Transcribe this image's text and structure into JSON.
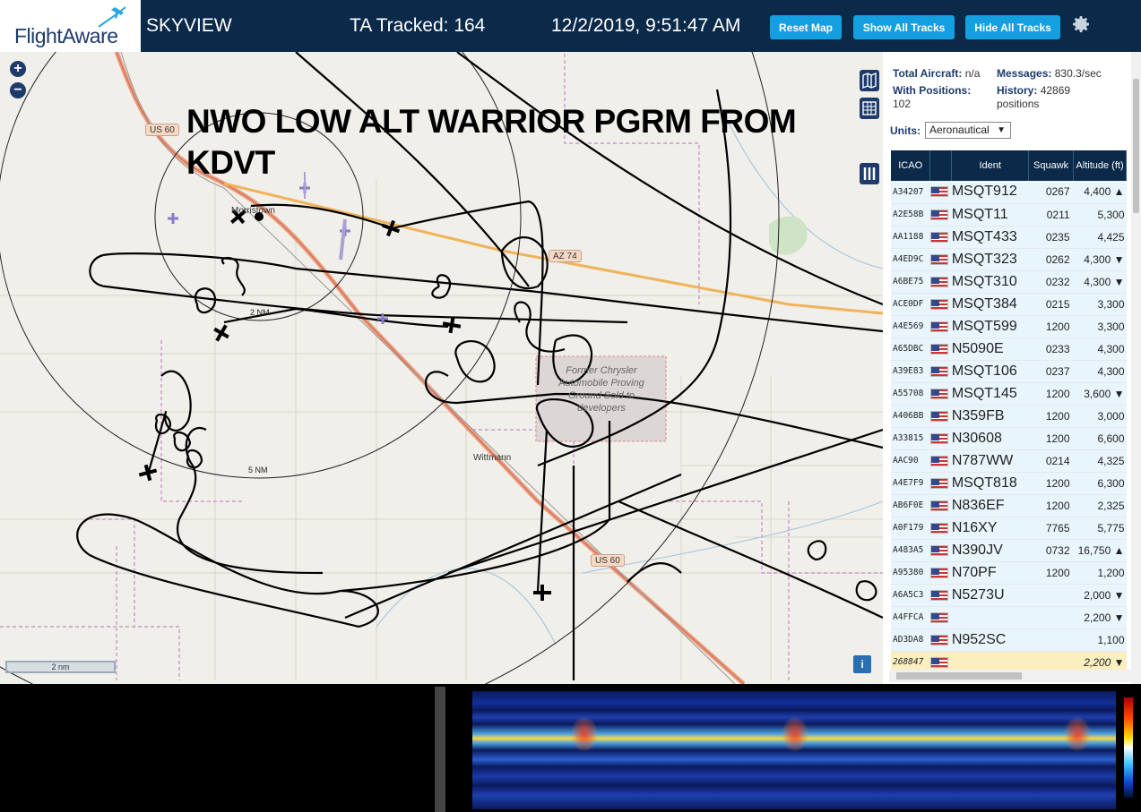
{
  "header": {
    "logo_text": "FlightAware",
    "title": "SKYVIEW",
    "tracked": "TA Tracked: 164",
    "datetime": "12/2/2019, 9:51:47 AM",
    "reset_label": "Reset Map",
    "show_label": "Show All Tracks",
    "hide_label": "Hide All Tracks"
  },
  "map": {
    "overlay_title_line1": "NWO LOW ALT WARRIOR PGRM FROM",
    "overlay_title_line2": "KDVT",
    "zoom_in": "+",
    "zoom_out": "−",
    "scale_label": "2 nm",
    "info_label": "i",
    "road_us60_a": "US 60",
    "road_az74": "AZ 74",
    "road_us60_b": "US 60",
    "place_morristown": "Morristown",
    "place_wittmann": "Wittmann",
    "ring_2nm": "2 NM",
    "ring_5nm": "5 NM",
    "proving_ground": "Former Chrysler Automobile Proving Ground Sold to developers"
  },
  "panel": {
    "total_aircraft_label": "Total Aircraft:",
    "total_aircraft_value": "n/a",
    "messages_label": "Messages:",
    "messages_value": "830.3/sec",
    "with_positions_label": "With Positions:",
    "with_positions_value": "102",
    "history_label": "History:",
    "history_value": "42869",
    "history_unit": "positions",
    "units_label": "Units:",
    "units_value": "Aeronautical",
    "columns": [
      "ICAO",
      "",
      "Ident",
      "Squawk",
      "Altitude (ft)"
    ],
    "rows": [
      {
        "icao": "A34207",
        "ident": "MSQT912",
        "squawk": "0267",
        "alt": "4,400 ▲"
      },
      {
        "icao": "A2E58B",
        "ident": "MSQT11",
        "squawk": "0211",
        "alt": "5,300"
      },
      {
        "icao": "AA1188",
        "ident": "MSQT433",
        "squawk": "0235",
        "alt": "4,425"
      },
      {
        "icao": "A4ED9C",
        "ident": "MSQT323",
        "squawk": "0262",
        "alt": "4,300 ▼"
      },
      {
        "icao": "A6BE75",
        "ident": "MSQT310",
        "squawk": "0232",
        "alt": "4,300 ▼"
      },
      {
        "icao": "ACE0DF",
        "ident": "MSQT384",
        "squawk": "0215",
        "alt": "3,300"
      },
      {
        "icao": "A4E569",
        "ident": "MSQT599",
        "squawk": "1200",
        "alt": "3,300"
      },
      {
        "icao": "A65DBC",
        "ident": "N5090E",
        "squawk": "0233",
        "alt": "4,300"
      },
      {
        "icao": "A39E83",
        "ident": "MSQT106",
        "squawk": "0237",
        "alt": "4,300"
      },
      {
        "icao": "A55708",
        "ident": "MSQT145",
        "squawk": "1200",
        "alt": "3,600 ▼"
      },
      {
        "icao": "A406BB",
        "ident": "N359FB",
        "squawk": "1200",
        "alt": "3,000"
      },
      {
        "icao": "A33815",
        "ident": "N30608",
        "squawk": "1200",
        "alt": "6,600"
      },
      {
        "icao": "AAC90",
        "ident": "N787WW",
        "squawk": "0214",
        "alt": "4,325"
      },
      {
        "icao": "A4E7F9",
        "ident": "MSQT818",
        "squawk": "1200",
        "alt": "6,300"
      },
      {
        "icao": "AB6F0E",
        "ident": "N836EF",
        "squawk": "1200",
        "alt": "2,325"
      },
      {
        "icao": "A0F179",
        "ident": "N16XY",
        "squawk": "7765",
        "alt": "5,775"
      },
      {
        "icao": "A483A5",
        "ident": "N390JV",
        "squawk": "0732",
        "alt": "16,750 ▲"
      },
      {
        "icao": "A95380",
        "ident": "N70PF",
        "squawk": "1200",
        "alt": "1,200"
      },
      {
        "icao": "A6A5C3",
        "ident": "N5273U",
        "squawk": "",
        "alt": "2,000 ▼"
      },
      {
        "icao": "A4FFCA",
        "ident": "",
        "squawk": "",
        "alt": "2,200 ▼"
      },
      {
        "icao": "AD3DA8",
        "ident": "N952SC",
        "squawk": "",
        "alt": "1,100"
      },
      {
        "icao": "268847",
        "ident": "",
        "squawk": "",
        "alt": "2,200 ▼"
      }
    ]
  },
  "colors": {
    "header_bg": "#0b2a4a",
    "button_bg": "#14a0e0",
    "map_bg": "#f1efe9",
    "track": "#000000",
    "highlight_row": "#fbefc0"
  },
  "icons": [
    "plane-logo-icon",
    "gear-icon",
    "zoom-in-icon",
    "zoom-out-icon",
    "map-layers-icon",
    "grid-icon",
    "columns-icon",
    "info-icon",
    "aircraft-icon"
  ]
}
